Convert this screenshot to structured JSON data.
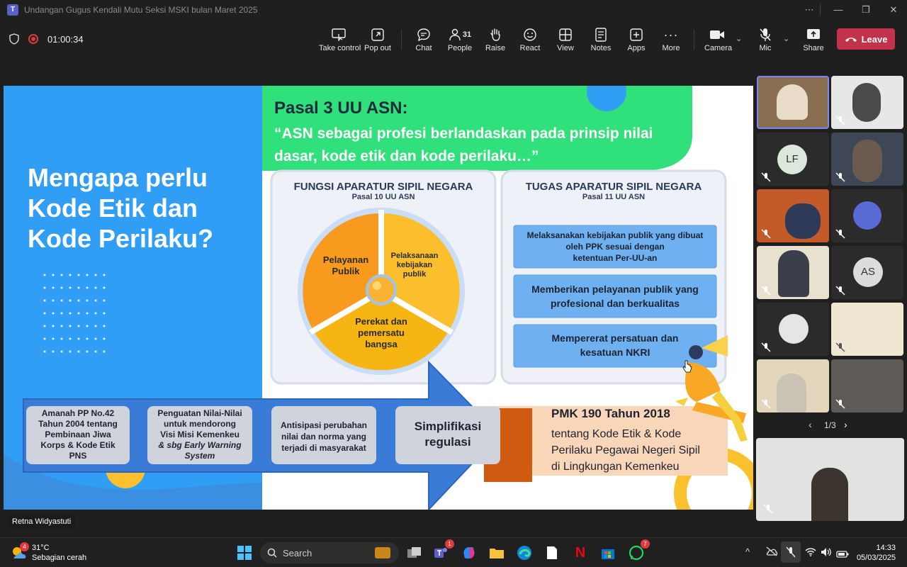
{
  "window": {
    "title": "Undangan Gugus Kendali Mutu Seksi MSKI bulan Maret 2025"
  },
  "meeting": {
    "timer": "01:00:34"
  },
  "toolbar": {
    "take_control": "Take control",
    "pop_out": "Pop out",
    "chat": "Chat",
    "people_count": "31",
    "people": "People",
    "raise": "Raise",
    "react": "React",
    "view": "View",
    "notes": "Notes",
    "apps": "Apps",
    "more": "More",
    "camera": "Camera",
    "mic": "Mic",
    "share": "Share",
    "leave": "Leave"
  },
  "slide": {
    "left_title_lines": [
      "Mengapa perlu",
      "Kode Etik dan",
      "Kode Perilaku?"
    ],
    "pasal_title": "Pasal 3 UU ASN:",
    "pasal_quote_1": "“ASN sebagai profesi berlandaskan pada prinsip nilai",
    "pasal_quote_2": "dasar, kode etik dan kode perilaku…”",
    "fungsi": {
      "title": "FUNGSI APARATUR SIPIL NEGARA",
      "subtitle": "Pasal 10 UU ASN",
      "pie_1_lines": [
        "Pelayanan",
        "Publik"
      ],
      "pie_2_lines": [
        "Pelaksanaan",
        "kebijakan",
        "publik"
      ],
      "pie_3_lines": [
        "Perekat dan",
        "pemersatu",
        "bangsa"
      ]
    },
    "tugas": {
      "title": "TUGAS APARATUR SIPIL NEGARA",
      "subtitle": "Pasal 11 UU ASN",
      "box_1_lines": [
        "Melaksanakan kebijakan publik yang dibuat",
        "oleh PPK sesuai dengan",
        "ketentuan Per-UU-an"
      ],
      "box_2_lines": [
        "Memberikan pelayanan publik yang",
        "profesional dan berkualitas"
      ],
      "box_3_lines": [
        "Mempererat persatuan dan",
        "kesatuan NKRI"
      ]
    },
    "arrow_items": [
      {
        "lines": [
          "Amanah PP No.42",
          "Tahun 2004 tentang",
          "Pembinaan Jiwa",
          "Korps & Kode Etik",
          "PNS"
        ]
      },
      {
        "lines": [
          "Penguatan Nilai-Nilai",
          "untuk mendorong",
          "Visi Misi Kemenkeu",
          "& sbg Early Warning",
          "System"
        ]
      },
      {
        "lines": [
          "Antisipasi perubahan",
          "nilai dan norma yang",
          "terjadi di masyarakat"
        ]
      },
      {
        "lines": [
          "Simplifikasi",
          "regulasi"
        ]
      }
    ],
    "pmk_title": "PMK 190 Tahun 2018",
    "pmk_lines": [
      "tentang Kode Etik & Kode",
      "Perilaku Pegawai Negeri Sipil",
      "di Lingkungan Kemenkeu"
    ]
  },
  "presenter": {
    "name": "Retna Widyastuti"
  },
  "gallery": {
    "initials_1": "LF",
    "initials_2": "AS",
    "page_indicator": "1/3"
  },
  "taskbar": {
    "weather_badge": "4",
    "temperature": "31°C",
    "weather_desc": "Sebagian cerah",
    "search_placeholder": "Search",
    "teams_badge": "1",
    "whatsapp_badge": "7",
    "time": "14:33",
    "date": "05/03/2025"
  },
  "colors": {
    "leave_red": "#c4314b",
    "slide_blue": "#2f9ef4",
    "slide_green": "#2fe07b",
    "pie_orange": "#f79a1e",
    "pie_yellow": "#fbc02d",
    "box_blue": "#6fb1f0",
    "pmk_orange": "#cf5a10",
    "pmk_peach": "#f9d6b8"
  }
}
